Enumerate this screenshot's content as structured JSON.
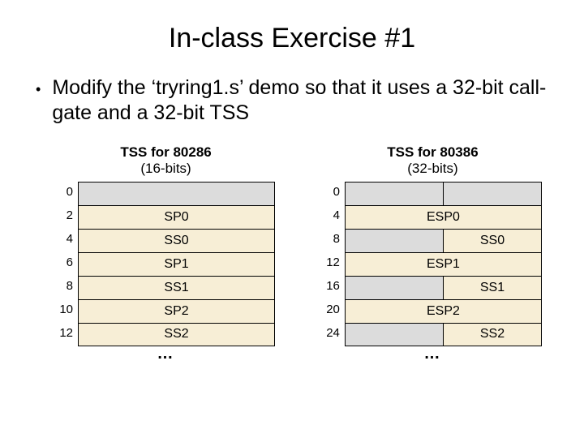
{
  "title": "In-class Exercise #1",
  "bullet": "Modify the ‘tryring1.s’ demo so that it uses a 32-bit call-gate and a 32-bit TSS",
  "left": {
    "head1": "TSS for 80286",
    "head2": "(16-bits)",
    "rows": [
      {
        "offset": "0",
        "label": ""
      },
      {
        "offset": "2",
        "label": "SP0"
      },
      {
        "offset": "4",
        "label": "SS0"
      },
      {
        "offset": "6",
        "label": "SP1"
      },
      {
        "offset": "8",
        "label": "SS1"
      },
      {
        "offset": "10",
        "label": "SP2"
      },
      {
        "offset": "12",
        "label": "SS2"
      }
    ],
    "ellipsis": "…"
  },
  "right": {
    "head1": "TSS for 80386",
    "head2": "(32-bits)",
    "rows": [
      {
        "offset": "0",
        "full": "",
        "half": ""
      },
      {
        "offset": "4",
        "full": "ESP0",
        "half": ""
      },
      {
        "offset": "8",
        "full": "",
        "half": "SS0"
      },
      {
        "offset": "12",
        "full": "ESP1",
        "half": ""
      },
      {
        "offset": "16",
        "full": "",
        "half": "SS1"
      },
      {
        "offset": "20",
        "full": "ESP2",
        "half": ""
      },
      {
        "offset": "24",
        "full": "",
        "half": "SS2"
      }
    ],
    "ellipsis": "…"
  }
}
